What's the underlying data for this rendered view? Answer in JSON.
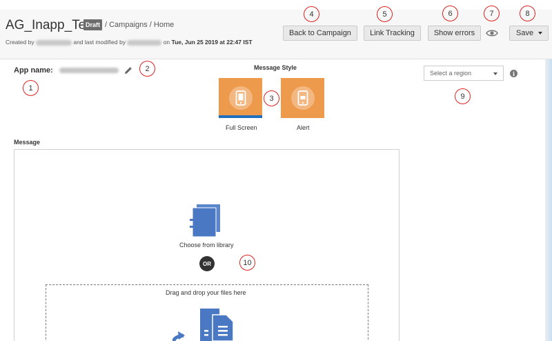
{
  "header": {
    "title": "AG_Inapp_Test",
    "badge": "Draft",
    "breadcrumb": "/ Campaigns / Home",
    "meta_created": "Created by",
    "meta_modified": "and last modified by",
    "meta_on": "on",
    "meta_date": "Tue, Jun 25 2019 at 22:47 IST"
  },
  "toolbar": {
    "back_label": "Back to Campaign",
    "link_label": "Link Tracking",
    "errors_label": "Show errors",
    "save_label": "Save"
  },
  "form": {
    "app_name_label": "App name:",
    "message_style_title": "Message Style",
    "styles": [
      {
        "label": "Full Screen",
        "selected": true
      },
      {
        "label": "Alert",
        "selected": false
      }
    ],
    "region_placeholder": "Select a region",
    "info_glyph": "i",
    "message_label": "Message",
    "library_label": "Choose from library",
    "or_label": "OR",
    "drop_label": "Drag and drop your files here"
  },
  "annotations": [
    "1",
    "2",
    "3",
    "4",
    "5",
    "6",
    "7",
    "8",
    "9",
    "10"
  ],
  "colors": {
    "tile_orange": "#ee9a4d",
    "selected_bar": "#1f6fbf",
    "icon_blue": "#4a78c2",
    "marker_red": "#d22222"
  },
  "icons": [
    "pencil-icon",
    "eye-icon",
    "phone-icon",
    "alert-icon",
    "library-icon",
    "files-icon",
    "info-icon",
    "caret-down-icon"
  ]
}
